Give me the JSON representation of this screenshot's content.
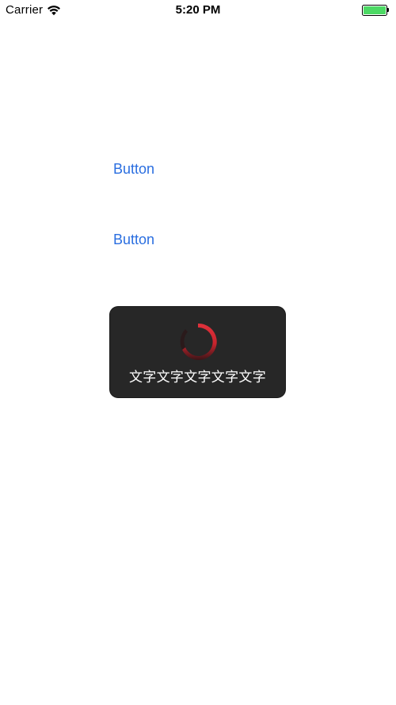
{
  "status_bar": {
    "carrier": "Carrier",
    "time": "5:20 PM",
    "battery_level": 1.0,
    "battery_color": "#4cd964",
    "wifi_icon": "wifi-icon"
  },
  "buttons": [
    {
      "label": "Button"
    },
    {
      "label": "Button"
    }
  ],
  "hud": {
    "spinner_icon": "loading-spinner-icon",
    "spinner_color": "#d0262f",
    "message": "文字文字文字文字文字"
  }
}
